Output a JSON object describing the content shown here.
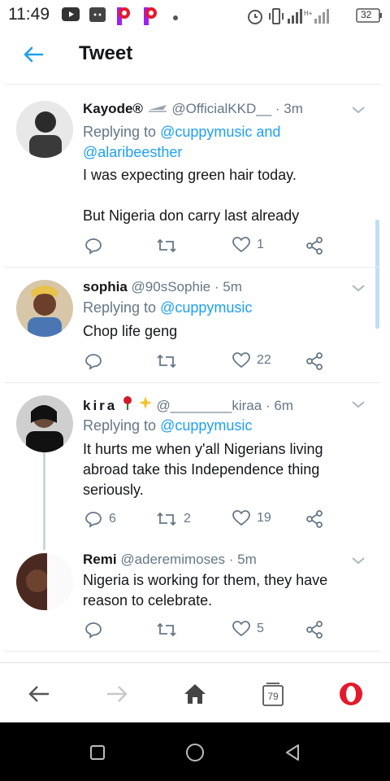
{
  "status_bar": {
    "time": "11:49",
    "battery": "32"
  },
  "header": {
    "title": "Tweet"
  },
  "tweets": [
    {
      "name": "Kayode®",
      "handle": "@OfficialKKD__",
      "time": "· 3m",
      "replying_prefix": "Replying to",
      "replying_1": "@cuppymusic and",
      "replying_2": "@alaribeesther",
      "text_1": "I was expecting green hair today.",
      "text_2": "But Nigeria don carry last already",
      "replies": "",
      "retweets": "",
      "likes": "1"
    },
    {
      "name": "sophia",
      "handle": "@90sSophie",
      "time": "· 5m",
      "replying_prefix": "Replying to",
      "replying_1": "@cuppymusic",
      "text_1": "Chop life geng",
      "replies": "",
      "retweets": "",
      "likes": "22"
    },
    {
      "name": "kira",
      "handle": "@________kiraa",
      "time": "· 6m",
      "replying_prefix": "Replying to",
      "replying_1": "@cuppymusic",
      "text_1": "It hurts me when y'all Nigerians living abroad take this Independence thing seriously.",
      "replies": "6",
      "retweets": "2",
      "likes": "19"
    },
    {
      "name": "Remi",
      "handle": "@aderemimoses",
      "time": "· 5m",
      "text_1": "Nigeria is working for them, they have reason to celebrate.",
      "replies": "",
      "retweets": "",
      "likes": "5"
    }
  ],
  "browser": {
    "tab_count": "79"
  },
  "colors": {
    "accent": "#1da1f2",
    "opera_red": "#e4192b"
  }
}
